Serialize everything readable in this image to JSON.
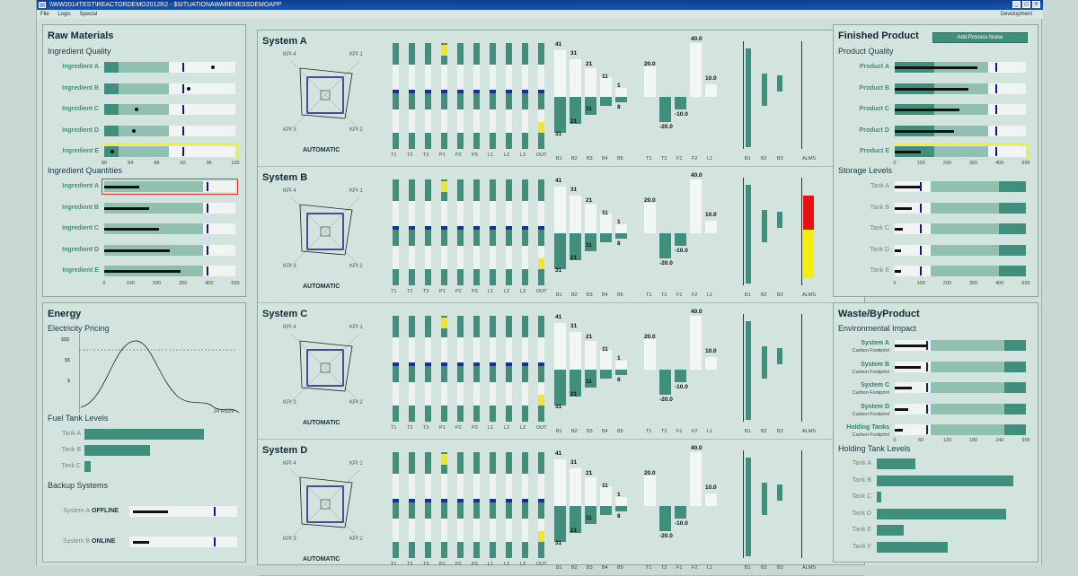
{
  "window": {
    "title": "\\\\WW2014TEST\\REACTORDEMO2012R2 - $SITUATIONAWARENESSDEMOAPP"
  },
  "menu": {
    "items": [
      "File",
      "Logic",
      "Special"
    ],
    "right": "Development"
  },
  "raw": {
    "title": "Raw Materials",
    "quality_title": "Ingredient Quality",
    "quality_rows": [
      {
        "label": "Ingredient A",
        "value": 0.85
      },
      {
        "label": "Ingredient B",
        "value": 0.66
      },
      {
        "label": "Ingredient C",
        "value": 0.24
      },
      {
        "label": "Ingredient D",
        "value": 0.22
      },
      {
        "label": "Ingredient E",
        "value": 0.05
      }
    ],
    "quality_axis": [
      "80",
      "84",
      "88",
      "92",
      "96",
      "100"
    ],
    "quantities_title": "Ingredient Quantities",
    "quantity_rows": [
      {
        "label": "Ingredient A",
        "value": 0.27
      },
      {
        "label": "Ingredient B",
        "value": 0.34
      },
      {
        "label": "Ingredient C",
        "value": 0.42
      },
      {
        "label": "Ingredient D",
        "value": 0.5
      },
      {
        "label": "Ingredient E",
        "value": 0.58
      }
    ],
    "quantity_axis": [
      "0",
      "100",
      "200",
      "300",
      "400",
      "500"
    ]
  },
  "energy": {
    "title": "Energy",
    "pricing_title": "Electricity Pricing",
    "price_ticks": [
      "$$$",
      "$$",
      "$"
    ],
    "price_xlabel": "24 Hours",
    "fuel_title": "Fuel Tank Levels",
    "fuel_rows": [
      {
        "label": "Tank A",
        "value": 0.95
      },
      {
        "label": "Tank B",
        "value": 0.52
      },
      {
        "label": "Tank C",
        "value": 0.05
      }
    ],
    "backup_title": "Backup Systems",
    "backup_rows": [
      {
        "label": "System A",
        "status": "OFFLINE",
        "value": 0.65
      },
      {
        "label": "System B",
        "status": "ONLINE",
        "value": 0.3
      }
    ]
  },
  "systems": [
    {
      "name": "System A",
      "mode": "AUTOMATIC",
      "alms": false
    },
    {
      "name": "System B",
      "mode": "AUTOMATIC",
      "alms": true
    },
    {
      "name": "System C",
      "mode": "AUTOMATIC",
      "alms": false
    },
    {
      "name": "System D",
      "mode": "AUTOMATIC",
      "alms": false
    }
  ],
  "sys_common": {
    "kpi": [
      "KPI 4",
      "KPI 1",
      "KPI 3",
      "KPI 2"
    ],
    "tank_axis": [
      "T1",
      "T2",
      "T3",
      "P1",
      "P2",
      "P3",
      "L1",
      "L2",
      "L3",
      "OUT"
    ],
    "b_axis": [
      "B1",
      "B2",
      "B3",
      "B4",
      "B5"
    ],
    "b_values": [
      "41",
      "31",
      "21",
      "11",
      "1",
      "8",
      "11",
      "21",
      "31"
    ],
    "t_axis": [
      "T1",
      "T2",
      "F1",
      "F2",
      "L1"
    ],
    "t_values": [
      "40.0",
      "20.0",
      "10.0",
      "-10.0",
      "-20.0"
    ],
    "bb_axis": [
      "B1",
      "B2",
      "B3"
    ],
    "alms": "ALMS"
  },
  "finished": {
    "title": "Finished Product",
    "button": "Add Process Noise",
    "quality_title": "Product Quality",
    "quality_rows": [
      {
        "label": "Product A",
        "value": 0.63
      },
      {
        "label": "Product B",
        "value": 0.56
      },
      {
        "label": "Product C",
        "value": 0.49
      },
      {
        "label": "Product D",
        "value": 0.45
      },
      {
        "label": "Product E",
        "value": 0.2
      }
    ],
    "quality_axis": [
      "0",
      "100",
      "200",
      "300",
      "400",
      "500"
    ],
    "storage_title": "Storage Levels",
    "storage_rows": [
      {
        "label": "Tank A",
        "value": 0.2
      },
      {
        "label": "Tank B",
        "value": 0.13
      },
      {
        "label": "Tank C",
        "value": 0.06
      },
      {
        "label": "Tank D",
        "value": 0.05
      },
      {
        "label": "Tank E",
        "value": 0.05
      }
    ],
    "storage_axis": [
      "0",
      "100",
      "200",
      "300",
      "400",
      "500"
    ]
  },
  "waste": {
    "title": "Waste/ByProduct",
    "env_title": "Environmental Impact",
    "env_rows": [
      {
        "label": "System A",
        "sub": "Carbon Footprint",
        "value": 0.25
      },
      {
        "label": "System B",
        "sub": "Carbon Footprint",
        "value": 0.2
      },
      {
        "label": "System C",
        "sub": "Carbon Footprint",
        "value": 0.13
      },
      {
        "label": "System D",
        "sub": "Carbon Footprint",
        "value": 0.1
      },
      {
        "label": "Holding Tanks",
        "sub": "Carbon Footprint",
        "value": 0.06
      }
    ],
    "env_axis": [
      "0",
      "60",
      "120",
      "180",
      "240",
      "300"
    ],
    "holding_title": "Holding Tank Levels",
    "holding_rows": [
      {
        "label": "Tank A",
        "value": 0.28
      },
      {
        "label": "Tank B",
        "value": 1.0
      },
      {
        "label": "Tank C",
        "value": 0.03
      },
      {
        "label": "Tank D",
        "value": 0.95
      },
      {
        "label": "Tank E",
        "value": 0.2
      },
      {
        "label": "Tank F",
        "value": 0.52
      }
    ]
  }
}
